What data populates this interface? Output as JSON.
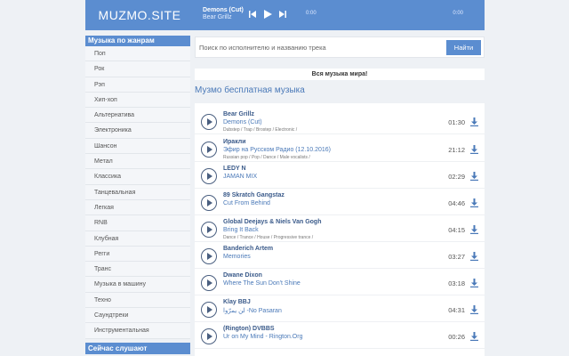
{
  "header": {
    "logo": "MUZMO.SITE",
    "now_playing": {
      "title": "Demons (Cut)",
      "artist": "Bear Grillz"
    },
    "time_current": "0:00",
    "time_total": "0:00"
  },
  "sidebar": {
    "genres_title": "Музыка по жанрам",
    "genres": [
      "Поп",
      "Рок",
      "Рэп",
      "Хип-хоп",
      "Альтернатива",
      "Электроника",
      "Шансон",
      "Метал",
      "Классика",
      "Танцевальная",
      "Легкая",
      "RNB",
      "Клубная",
      "Регги",
      "Транс",
      "Музыка в машину",
      "Техно",
      "Саундтреки",
      "Инструментальная"
    ],
    "listening_title": "Сейчас слушают"
  },
  "search": {
    "placeholder": "Поиск по исполнителю и названию трека",
    "button": "Найти"
  },
  "banner": "Вся музыка мира!",
  "section_title": "Музмо бесплатная музыка",
  "tracks": [
    {
      "artist": "Bear Grillz",
      "title": "Demons (Cut)",
      "tags": "Dubstep  /  Trap  /  Brostep  /  Electronic  /",
      "duration": "01:30"
    },
    {
      "artist": "Иракли",
      "title": "Эфир на Русском Радио (12.10.2016)",
      "tags": "Russian pop  /  Pop  /  Dance  /  Male vocalists  /",
      "duration": "21:12"
    },
    {
      "artist": "LEDY N",
      "title": "JAMAN MIX",
      "tags": "",
      "duration": "02:29"
    },
    {
      "artist": "89 Skratch Gangstaz",
      "title": "Cut From Behind",
      "tags": "",
      "duration": "04:46"
    },
    {
      "artist": "Global Deejays & Niels Van Gogh",
      "title": "Bring It Back",
      "tags": "Dance  /  Trance  /  House  /  Progressive trance  /",
      "duration": "04:15"
    },
    {
      "artist": "Banderich Artem",
      "title": "Memories",
      "tags": "",
      "duration": "03:27"
    },
    {
      "artist": "Dwane Dixon",
      "title": "Where The Sun Don't Shine",
      "tags": "",
      "duration": "03:18"
    },
    {
      "artist": "Klay BBJ",
      "title": "لن يمرّوا -No Pasaran",
      "tags": "",
      "duration": "04:31"
    },
    {
      "artist": "(Rington) DVBBS",
      "title": "Ur on My Mind - Rington.Org",
      "tags": "",
      "duration": "00:26"
    }
  ],
  "colors": {
    "accent": "#5b8dd0",
    "link": "#4a79b8",
    "background": "#eef1f5"
  },
  "icons": {
    "prev": "skip-back-icon",
    "play": "play-icon",
    "next": "skip-forward-icon",
    "track_play": "play-circle-icon",
    "download": "download-icon"
  }
}
